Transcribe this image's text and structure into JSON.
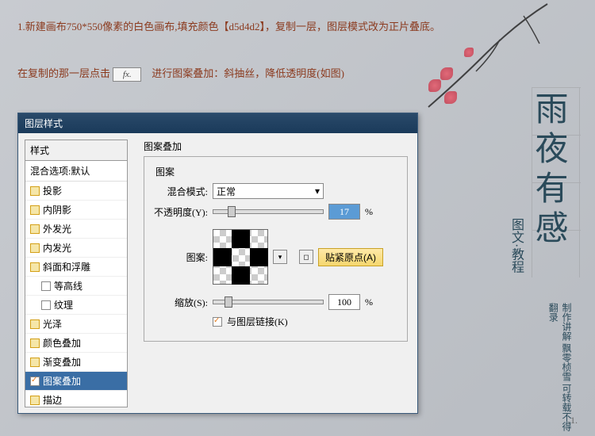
{
  "tutorial": {
    "line1": "1.新建画布750*550像素的白色画布,填充颜色【d5d4d2】，复制一层，图层模式改为正片叠底。",
    "line2a": "在复制的那一层点击",
    "fx": "fx.",
    "line2b": "进行图案叠加：斜抽丝，降低透明度(如图)"
  },
  "dialog": {
    "title": "图层样式",
    "styles_header": "样式",
    "blend_default": "混合选项:默认",
    "items": [
      {
        "label": "投影",
        "checked": false
      },
      {
        "label": "内阴影",
        "checked": false
      },
      {
        "label": "外发光",
        "checked": false
      },
      {
        "label": "内发光",
        "checked": false
      },
      {
        "label": "斜面和浮雕",
        "checked": false
      },
      {
        "label": "等高线",
        "checked": false,
        "indent": true
      },
      {
        "label": "纹理",
        "checked": false,
        "indent": true
      },
      {
        "label": "光泽",
        "checked": false
      },
      {
        "label": "颜色叠加",
        "checked": false
      },
      {
        "label": "渐变叠加",
        "checked": false
      },
      {
        "label": "图案叠加",
        "checked": true,
        "selected": true
      },
      {
        "label": "描边",
        "checked": false
      }
    ]
  },
  "panel": {
    "title": "图案叠加",
    "group": "图案",
    "blend_mode_label": "混合模式:",
    "blend_mode_value": "正常",
    "opacity_label": "不透明度(Y):",
    "opacity_value": "17",
    "opacity_unit": "%",
    "pattern_label": "图案:",
    "snap_label": "贴紧原点(A)",
    "scale_label": "缩放(S):",
    "scale_value": "100",
    "scale_unit": "%",
    "link_label": "与图层链接(K)"
  },
  "deco": {
    "title": "雨夜有感",
    "sub": "图文·教程",
    "credit1": "可转载不得翻录",
    "credit2": "制作讲解 飘零桢雪"
  },
  "page": ".1."
}
